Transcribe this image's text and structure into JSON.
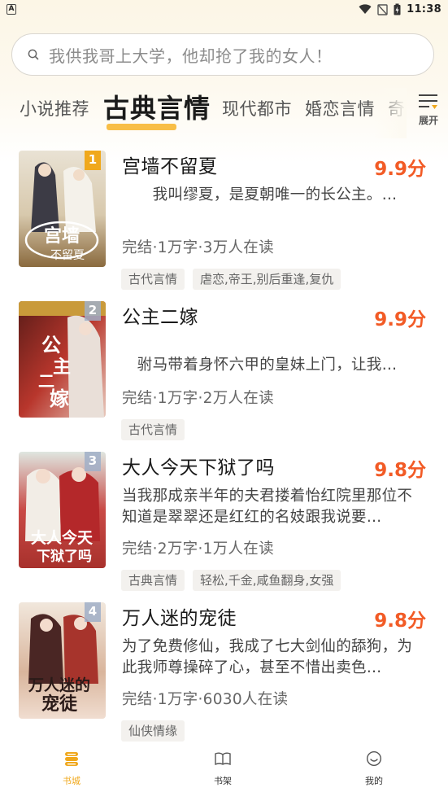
{
  "status_bar": {
    "notification_letter": "A",
    "time": "11:38"
  },
  "search": {
    "placeholder": "我供我哥上大学，他却抢了我的女人！"
  },
  "tabs": [
    {
      "label": "小说推荐",
      "active": false
    },
    {
      "label": "古典言情",
      "active": true
    },
    {
      "label": "现代都市",
      "active": false
    },
    {
      "label": "婚恋言情",
      "active": false
    },
    {
      "label": "奇",
      "active": false
    }
  ],
  "expand_label": "展开",
  "books": [
    {
      "rank": "1",
      "title": "宫墙不留夏",
      "score": "9.9分",
      "description": "　　我叫缪夏，是夏朝唯一的长公主。…",
      "meta": "完结·1万字·3万人在读",
      "tags": [
        "古代言情",
        "虐恋,帝王,别后重逢,复仇"
      ],
      "cover_title": "宫墙不留夏"
    },
    {
      "rank": "2",
      "title": "公主二嫁",
      "score": "9.9分",
      "description": "　驸马带着身怀六甲的皇妹上门，让我…",
      "meta": "完结·1万字·2万人在读",
      "tags": [
        "古代言情"
      ],
      "cover_title": "公主二嫁"
    },
    {
      "rank": "3",
      "title": "大人今天下狱了吗",
      "score": "9.8分",
      "description": "当我那成亲半年的夫君搂着怡红院里那位不知道是翠翠还是红红的名妓跟我说要…",
      "meta": "完结·2万字·1万人在读",
      "tags": [
        "古典言情",
        "轻松,千金,咸鱼翻身,女强"
      ],
      "cover_title": "大人今天下狱了吗"
    },
    {
      "rank": "4",
      "title": "万人迷的宠徒",
      "score": "9.8分",
      "description": "为了免费修仙，我成了七大剑仙的舔狗，为此我师尊操碎了心，甚至不惜出卖色…",
      "meta": "完结·1万字·6030人在读",
      "tags": [
        "仙侠情缘"
      ],
      "cover_title": "万人迷的宠徒"
    }
  ],
  "bottom_nav": [
    {
      "label": "书城",
      "icon": "bookstore-icon",
      "active": true
    },
    {
      "label": "书架",
      "icon": "bookshelf-icon",
      "active": false
    },
    {
      "label": "我的",
      "icon": "profile-icon",
      "active": false
    }
  ],
  "colors": {
    "accent": "#f0a81c",
    "score": "#f25b26",
    "tab_underline": "#f7b733"
  }
}
